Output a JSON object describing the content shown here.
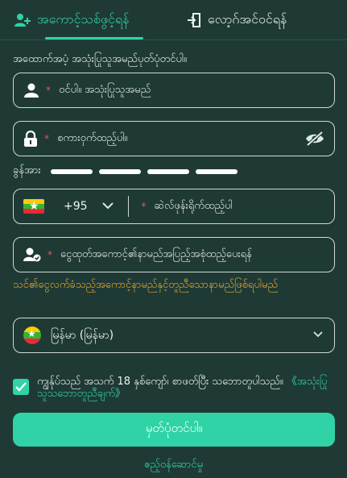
{
  "tabs": {
    "register": "အကောင့်သစ်ဖွင့်ရန်",
    "login": "လော့ဂ်အင်ဝင်ရန်"
  },
  "form": {
    "username_label": "အထောက်အပံ့ အသုံးပြုသူအမည်ပုတ်ပုံတင်ပါ။",
    "username_placeholder": "ဝင်ပါ။ အသုံးပြုသူအမည်",
    "password_placeholder": "စကားဝှက်ထည့်ပါ။",
    "strength_label": "ခွန်အား",
    "phone_code": "+95",
    "phone_placeholder": "ဆဲလ်ဖုန်းရိုက်ထည့်ပါ",
    "name_placeholder": "ငွေထုတ်အကောင့်၏နာမည်အပြည့်အစုံထည့်ပေးရန်",
    "name_hint": "သင်၏ငွေလက်ခံသည့်အကောင့်နာမည်နှင့်တူညီသောနာမည်ဖြစ်ရပါမည်",
    "country_value": "မြန်မာ   (မြန်မာ)",
    "required_mark": "*"
  },
  "agreement": {
    "text": "ကျွန်ုပ်သည် အသက် 18 နှစ်ကျော်၊ စာဖတ်ပြီး သဘောတူပါသည်။",
    "link": "《အသုံးပြုသူသဘောတူညီချက်》"
  },
  "submit_label": "မှတ်ပုံတင်ပါ။",
  "support_link": "ဧည့်ဝန်ဆောင်မှု",
  "colors": {
    "background": "#1f3a35",
    "accent": "#2fd3a6",
    "warning": "#e3a634",
    "required": "#e25a5a"
  },
  "password_strength_bars": 4
}
